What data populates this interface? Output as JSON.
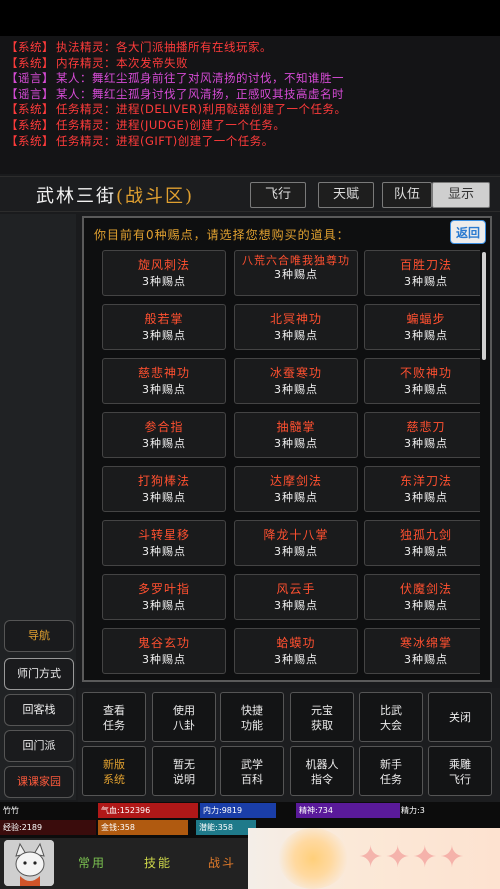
{
  "log": [
    {
      "tag": "【系统】",
      "text": "执法精灵：各大门派抽播所有在线玩家。",
      "color": "sys"
    },
    {
      "tag": "【系统】",
      "text": "内存精灵：本次发帝失败",
      "color": "sys"
    },
    {
      "tag": "【谣言】",
      "text": "某人：舞红尘孤身前往了对风清扬的讨伐，不知谁胜一",
      "color": "rumor"
    },
    {
      "tag": "【谣言】",
      "text": "某人：舞红尘孤身讨伐了风清扬，正感叹其技高虚名时",
      "color": "rumor"
    },
    {
      "tag": "【系统】",
      "text": "任务精灵：进程(DELIVER)利用鞑器创建了一个任务。",
      "color": "sys"
    },
    {
      "tag": "【系统】",
      "text": "任务精灵：进程(JUDGE)创建了一个任务。",
      "color": "sys"
    },
    {
      "tag": "【系统】",
      "text": "任务精灵：进程(GIFT)创建了一个任务。",
      "color": "sys"
    }
  ],
  "header": {
    "title": "武林三街",
    "subtitle": "(战斗区)",
    "buttons": [
      "飞行",
      "天赋",
      "队伍",
      "显示"
    ]
  },
  "sidebar": [
    "导航",
    "师门方式",
    "回客栈",
    "回门派",
    "课课家园"
  ],
  "dialog": {
    "prompt": "你目前有0种赐点，请选择您想购买的道具：",
    "back_label": "返回",
    "items": [
      {
        "name": "旋风刺法",
        "cost": "3种赐点"
      },
      {
        "name": "八荒六合唯我独尊功",
        "cost": "3种赐点"
      },
      {
        "name": "百胜刀法",
        "cost": "3种赐点"
      },
      {
        "name": "般若掌",
        "cost": "3种赐点"
      },
      {
        "name": "北冥神功",
        "cost": "3种赐点"
      },
      {
        "name": "蝙蝠步",
        "cost": "3种赐点"
      },
      {
        "name": "慈悲神功",
        "cost": "3种赐点"
      },
      {
        "name": "冰蚕寒功",
        "cost": "3种赐点"
      },
      {
        "name": "不败神功",
        "cost": "3种赐点"
      },
      {
        "name": "参合指",
        "cost": "3种赐点"
      },
      {
        "name": "抽髓掌",
        "cost": "3种赐点"
      },
      {
        "name": "慈悲刀",
        "cost": "3种赐点"
      },
      {
        "name": "打狗棒法",
        "cost": "3种赐点"
      },
      {
        "name": "达摩剑法",
        "cost": "3种赐点"
      },
      {
        "name": "东洋刀法",
        "cost": "3种赐点"
      },
      {
        "name": "斗转星移",
        "cost": "3种赐点"
      },
      {
        "name": "降龙十八掌",
        "cost": "3种赐点"
      },
      {
        "name": "独孤九剑",
        "cost": "3种赐点"
      },
      {
        "name": "多罗叶指",
        "cost": "3种赐点"
      },
      {
        "name": "风云手",
        "cost": "3种赐点"
      },
      {
        "name": "伏魔剑法",
        "cost": "3种赐点"
      },
      {
        "name": "鬼谷玄功",
        "cost": "3种赐点"
      },
      {
        "name": "蛤蟆功",
        "cost": "3种赐点"
      },
      {
        "name": "寒冰绵掌",
        "cost": "3种赐点"
      }
    ]
  },
  "actions": [
    {
      "label": "查看\n任务",
      "gold": false
    },
    {
      "label": "使用\n八卦",
      "gold": false
    },
    {
      "label": "快捷\n功能",
      "gold": false
    },
    {
      "label": "元宝\n获取",
      "gold": false
    },
    {
      "label": "比武\n大会",
      "gold": false
    },
    {
      "label": "关闭",
      "gold": false
    },
    {
      "label": "新版\n系统",
      "gold": true
    },
    {
      "label": "暂无\n说明",
      "gold": false
    },
    {
      "label": "武学\n百科",
      "gold": false
    },
    {
      "label": "机器人\n指令",
      "gold": false
    },
    {
      "label": "新手\n任务",
      "gold": false
    },
    {
      "label": "乘雕\n飞行",
      "gold": false
    }
  ],
  "stats": {
    "name": "竹竹",
    "hp": "气血:152396",
    "neili": "内力:9819",
    "jingshen": "精神:734",
    "jing": "精力:3",
    "exp": "经验:2189",
    "gold": "金钱:358",
    "qianneng": "潜能:358"
  },
  "bottom_tabs": [
    "常用",
    "技能",
    "战斗"
  ],
  "colors": {
    "system_red": "#ff3b3b",
    "rumor_purple": "#d64bd6",
    "gold": "#e0a030",
    "hp_bar": "#b01818",
    "neili_bar": "#1a3ea8",
    "jingshen_bar": "#5a1a9a",
    "gold_bar": "#b05a10",
    "qianneng_bar": "#1f7a8a"
  }
}
